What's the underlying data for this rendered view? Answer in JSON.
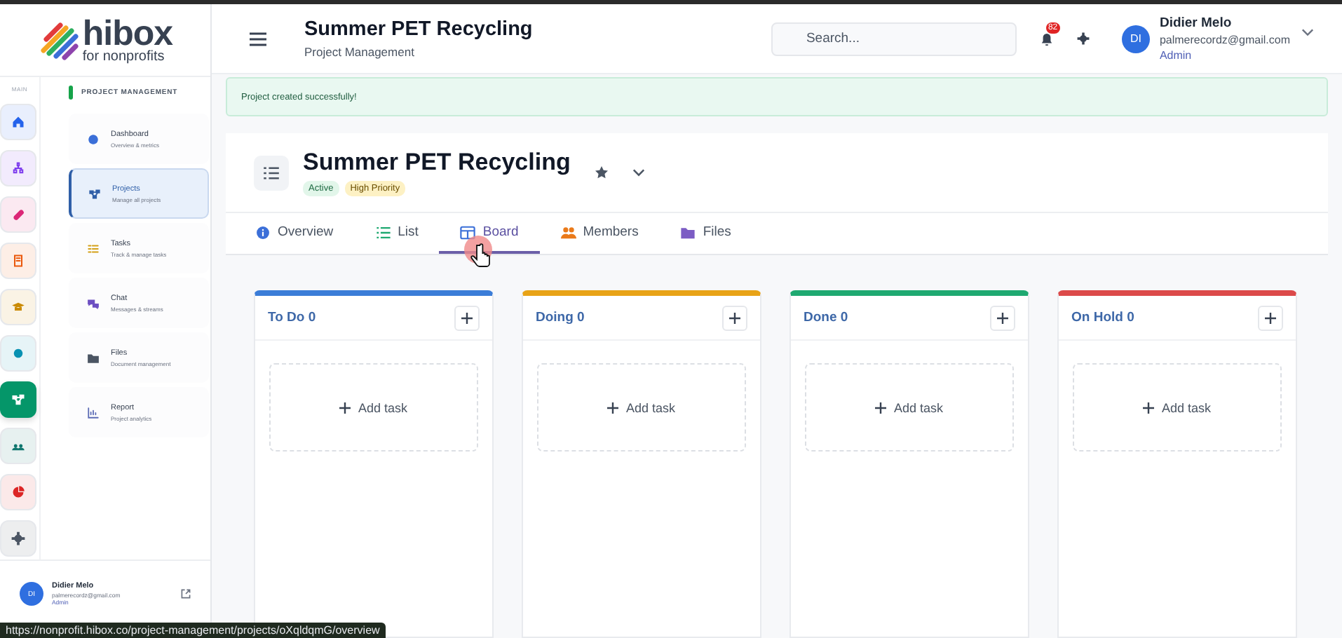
{
  "logo": {
    "name": "hibox",
    "tagline": "for nonprofits"
  },
  "rail": {
    "label": "MAIN",
    "items": [
      {
        "color": "#2563eb",
        "selected": false
      },
      {
        "color": "#7c3aed",
        "selected": false
      },
      {
        "color": "#db2777",
        "selected": false
      },
      {
        "color": "#ea580c",
        "selected": false
      },
      {
        "color": "#ca8a04",
        "selected": false
      },
      {
        "color": "#0891b2",
        "selected": false
      },
      {
        "color": "#059669",
        "selected": true
      },
      {
        "color": "#0f766e",
        "selected": false
      },
      {
        "color": "#dc2626",
        "selected": false
      },
      {
        "color": "#4b5563",
        "selected": false
      }
    ]
  },
  "sidebar": {
    "section": "PROJECT MANAGEMENT",
    "items": [
      {
        "title": "Dashboard",
        "subtitle": "Overview & metrics",
        "selected": false
      },
      {
        "title": "Projects",
        "subtitle": "Manage all projects",
        "selected": true
      },
      {
        "title": "Tasks",
        "subtitle": "Track & manage tasks",
        "selected": false
      },
      {
        "title": "Chat",
        "subtitle": "Messages & streams",
        "selected": false
      },
      {
        "title": "Files",
        "subtitle": "Document management",
        "selected": false
      },
      {
        "title": "Report",
        "subtitle": "Project analytics",
        "selected": false
      }
    ],
    "user": {
      "initials": "DI",
      "name": "Didier Melo",
      "email": "palmerecordz@gmail.com",
      "role": "Admin"
    }
  },
  "header": {
    "title": "Summer PET Recycling",
    "subtitle": "Project Management",
    "search": {
      "placeholder": "Search..."
    },
    "notifications": "82",
    "user": {
      "initials": "DI",
      "name": "Didier Melo",
      "email": "palmerecordz@gmail.com",
      "role": "Admin"
    }
  },
  "alert": "Project created successfully!",
  "project": {
    "title": "Summer PET Recycling",
    "badges": [
      {
        "label": "Active",
        "kind": "status"
      },
      {
        "label": "High Priority",
        "kind": "priority"
      }
    ]
  },
  "tabs": [
    {
      "label": "Overview",
      "selected": false
    },
    {
      "label": "List",
      "selected": false
    },
    {
      "label": "Board",
      "selected": true
    },
    {
      "label": "Members",
      "selected": false
    },
    {
      "label": "Files",
      "selected": false
    }
  ],
  "board": {
    "columns": [
      {
        "title": "To Do 0",
        "color": "#3b7dd8",
        "add_label": "Add task"
      },
      {
        "title": "Doing 0",
        "color": "#e8a317",
        "add_label": "Add task"
      },
      {
        "title": "Done 0",
        "color": "#1fa971",
        "add_label": "Add task"
      },
      {
        "title": "On Hold 0",
        "color": "#dc4a4a",
        "add_label": "Add task"
      }
    ]
  },
  "status_url": "https://nonprofit.hibox.co/project-management/projects/oXqldqmG/overview"
}
